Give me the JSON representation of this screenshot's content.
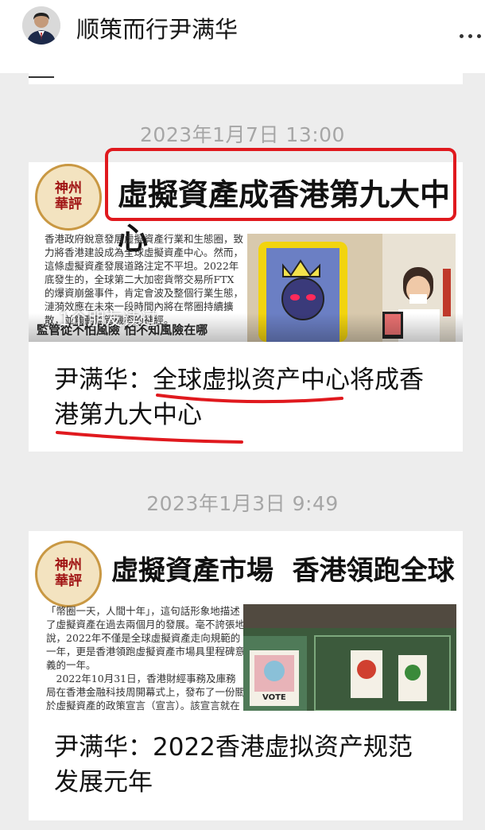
{
  "account": {
    "name": "顺策而行尹满华",
    "avatar_icon": "person-avatar-icon",
    "more_icon": "more-dots-icon"
  },
  "articles": [
    {
      "time": "2023年1月7日  13:00",
      "image": {
        "logo_text": "神州\n華評",
        "headline": "虛擬資產成香港第九大中心",
        "body": "香港政府銳意發展虛擬資產行業和生態圈，致力將香港建設成為全球虛擬資產中心。然而，這條虛擬資產發展道路注定不平坦。2022年底發生的，全球第二大加密貨幣交易所FTX的爆資崩盤事件，肯定會波及整個行業生態，漣漪效應在未來一段時間內將在幣圈持續擴散，並觸動監管機構的神經。",
        "caption": "監管從不怕風險  怕不知風險在哪",
        "read_hint": "1个朋友读过"
      },
      "title": "尹满华：全球虚拟资产中心将成香港第九大中心"
    },
    {
      "time": "2023年1月3日  9:49",
      "image": {
        "logo_text": "神州\n華評",
        "headline": "虛擬資產市場  香港領跑全球",
        "body": "「幣圈一天，人間十年」，這句話形象地描述了虛擬資產在過去兩個月的發展。毫不誇張地說，2022年不僅是全球虛擬資產走向規範的一年，更是香港領跑虛擬資產市場具里程碑意義的一年。\n　2022年10月31日，香港財經事務及庫務局在香港金融科技周開幕式上，發布了一份關於虛擬資產的政策宣言（宣言）。該宣言就在香港發展蓬勃的虛擬資產行業和生態圈，",
        "vote_text": "VOTE"
      },
      "title": "尹满华：2022香港虚拟资产规范发展元年"
    }
  ],
  "colors": {
    "annotation_red": "#e0191e",
    "background": "#ededed",
    "time_gray": "#a6a6a6"
  }
}
